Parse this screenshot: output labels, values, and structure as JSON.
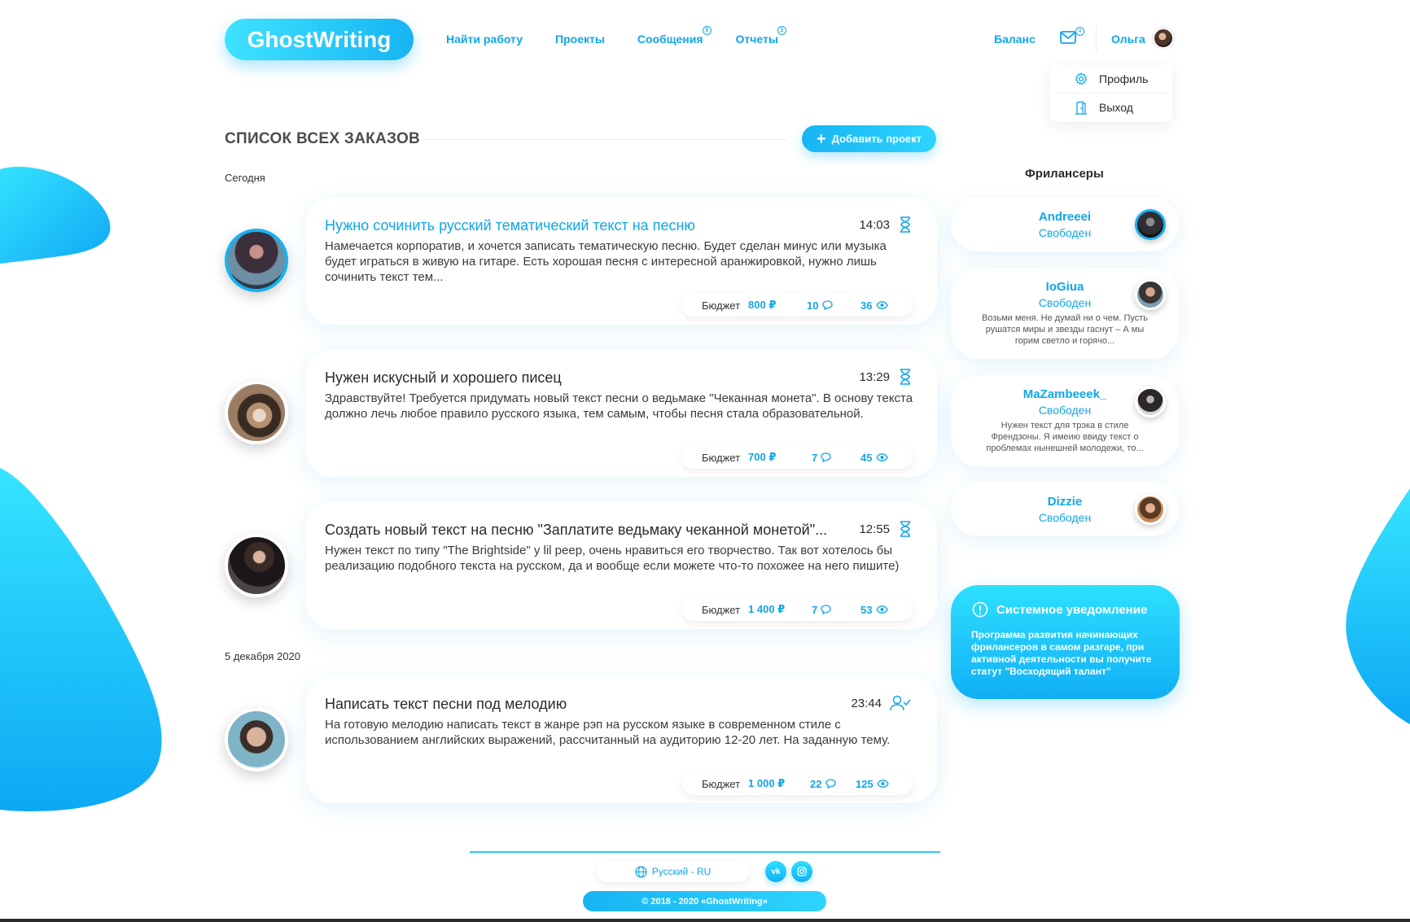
{
  "header": {
    "logo": "GhostWriting",
    "nav": [
      {
        "label": "Найти работу",
        "badge": ""
      },
      {
        "label": "Проекты",
        "badge": ""
      },
      {
        "label": "Сообщения",
        "badge": "3"
      },
      {
        "label": "Отчеты",
        "badge": "1"
      }
    ],
    "balance": "Баланс",
    "mail_badge": "4",
    "user_name": "Ольга",
    "dropdown": {
      "profile": "Профиль",
      "logout": "Выход"
    }
  },
  "main": {
    "title": "СПИСОК ВСЕХ ЗАКАЗОВ",
    "add_button": "Добавить проект",
    "groups": [
      {
        "date": "Сегодня",
        "orders": [
          {
            "title": "Нужно сочинить русский тематический текст на песню",
            "time": "14:03",
            "status_icon": "hourglass-icon",
            "text": "Намечается корпоратив, и хочется  записать тематическую песню. Будет сделан минус или музыка будет играться в живую на гитаре. Есть хорошая песня с интересной аранжировкой, нужно лишь сочинить текст тем...",
            "budget_label": "Бюджет",
            "budget": "800 ₽",
            "comments": "10",
            "views": "36"
          },
          {
            "title": "Нужен искусный и хорошего писец",
            "time": "13:29",
            "status_icon": "hourglass-icon",
            "text": "Здравствуйте! Требуется придумать новый текст песни о ведьмаке \"Чеканная монета\". В основу текста должно лечь любое правило русского языка, тем самым, чтобы песня стала образовательной.",
            "budget_label": "Бюджет",
            "budget": "700 ₽",
            "comments": "7",
            "views": "45"
          },
          {
            "title": "Создать новый текст на песню \"Заплатите ведьмаку чеканной монетой\"...",
            "time": "12:55",
            "status_icon": "hourglass-icon",
            "text": "Нужен текст по типу \"The Brightside\" у lil peep, очень нравиться его творчество. Так вот хотелось бы реализацию подобного текста на русском, да и вообще если можете что-то похожее на него пишите)",
            "budget_label": "Бюджет",
            "budget": "1 400 ₽",
            "comments": "7",
            "views": "53"
          }
        ]
      },
      {
        "date": "5 декабря 2020",
        "orders": [
          {
            "title": "Написать текст песни под мелодию",
            "time": "23:44",
            "status_icon": "user-check-icon",
            "text": "На готовую мелодию написать текст в жанре рэп на русском языке в современном стиле с использованием английских выражений, рассчитанный на аудиторию 12-20 лет. На заданную тему.",
            "budget_label": "Бюджет",
            "budget": "1 000 ₽",
            "comments": "22",
            "views": "125"
          }
        ]
      }
    ]
  },
  "sidebar": {
    "freelancers_title": "Фрилансеры",
    "freelancers": [
      {
        "name": "Andreeei",
        "status": "Свободен",
        "text": ""
      },
      {
        "name": "IoGiua",
        "status": "Свободен",
        "text": "Возьми меня. Не думай ни о чем. Пусть рушатся миры и звезды гаснут – А мы горим светло и горячо..."
      },
      {
        "name": "MaZambeeek_",
        "status": "Свободен",
        "text": "Нужен текст для трэка в стиле Френдзоны. Я имеию ввиду текст о проблемах нынешней молодежи, то..."
      },
      {
        "name": "Dizzie",
        "status": "Свободен",
        "text": ""
      }
    ],
    "system": {
      "title": "Системное уведомление",
      "text": "Программа развития начинающих фрилансеров в самом разгаре, при активной деятельности вы получите статут \"Восходящий талант\""
    }
  },
  "footer": {
    "language": "Русский - RU",
    "social": [
      "vk",
      "instagram"
    ],
    "copyright": "© 2018 - 2020 «GhostWriting»"
  },
  "colors": {
    "accent": "#10a6e8",
    "gradient_light": "#2ee0ff",
    "gradient_dark": "#11aff5"
  }
}
